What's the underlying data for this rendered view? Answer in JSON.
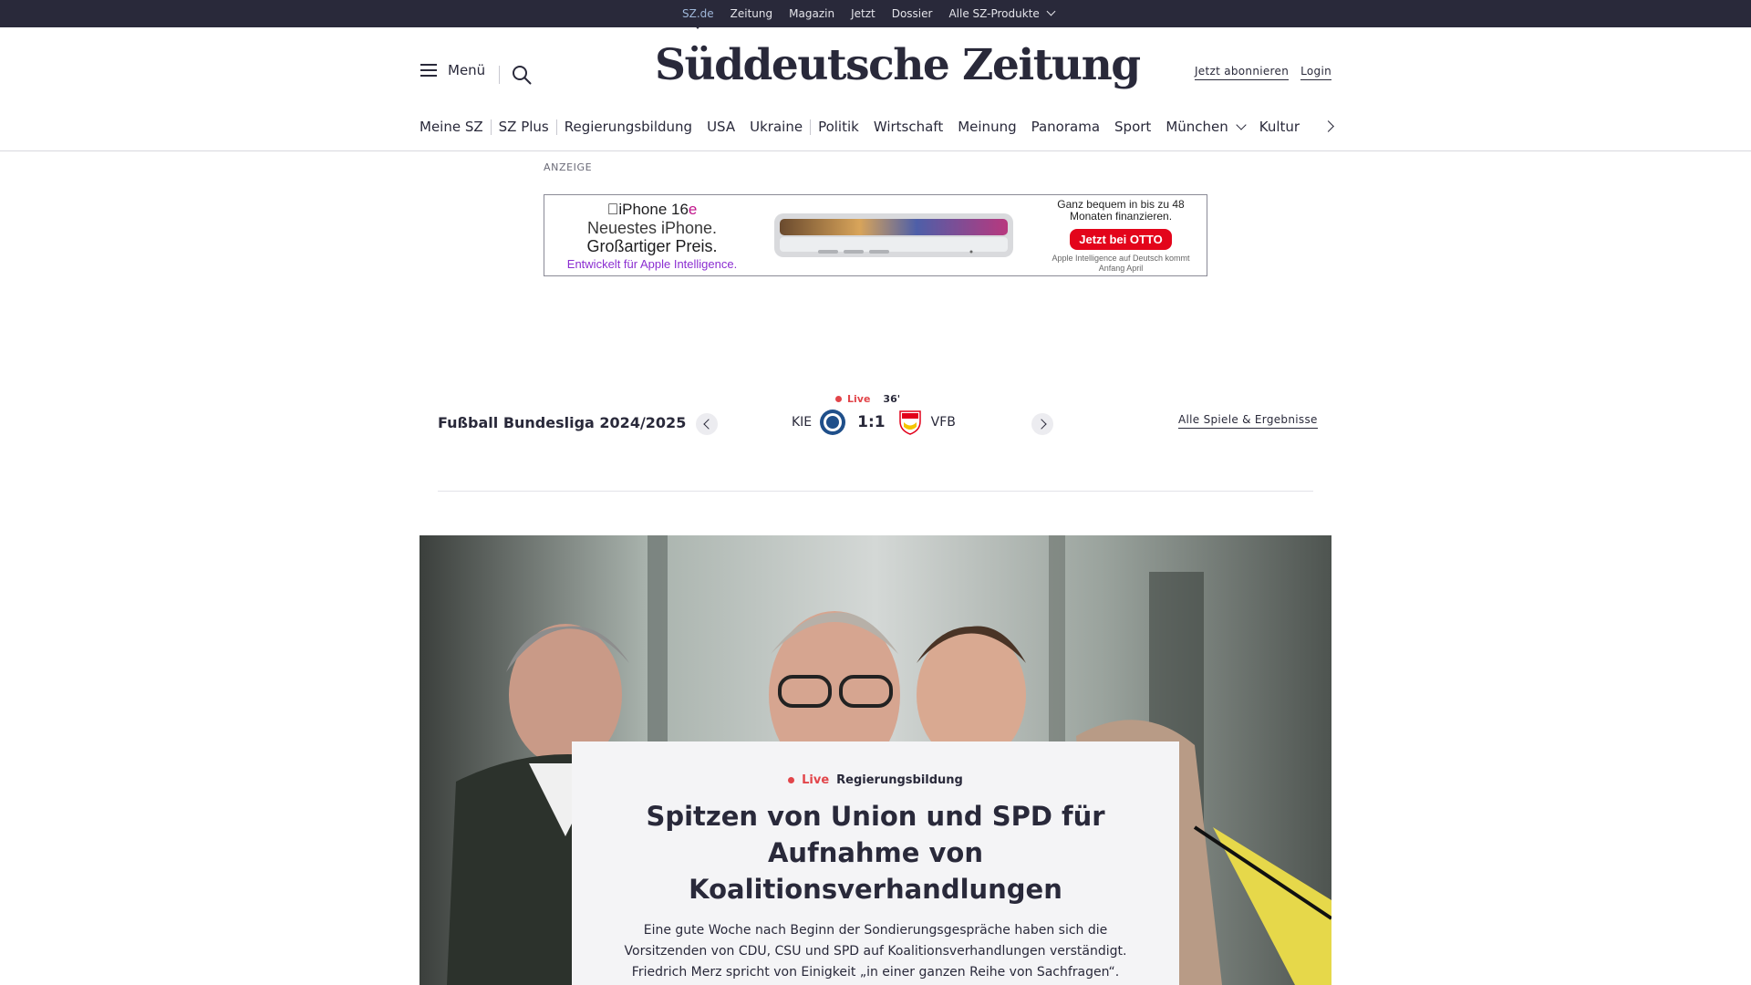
{
  "topnav": {
    "items": [
      "SZ.de",
      "Zeitung",
      "Magazin",
      "Jetzt",
      "Dossier",
      "Alle SZ-Produkte"
    ]
  },
  "header": {
    "menu_label": "Menü",
    "logo": "Süddeutsche Zeitung",
    "subscribe": "Jetzt abonnieren",
    "login": "Login"
  },
  "categories": [
    "Meine SZ",
    "SZ Plus",
    "Regierungsbildung",
    "USA",
    "Ukraine",
    "Politik",
    "Wirtschaft",
    "Meinung",
    "Panorama",
    "Sport",
    "München",
    "Kultur"
  ],
  "ad": {
    "label": "ANZEIGE",
    "product": "iPhone 16",
    "product_suffix": "e",
    "tagline1": "Neuestes iPhone.",
    "tagline2": "Großartiger Preis.",
    "ai_line": "Entwickelt für Apple Intelligence.",
    "financing": "Ganz bequem in bis zu 48 Monaten finanzieren.",
    "cta": "Jetzt bei OTTO",
    "note": "Apple Intelligence auf Deutsch kommt Anfang April",
    "accent": "#e3051b"
  },
  "scores": {
    "league": "Fußball Bundesliga 2024/2025",
    "live": "Live",
    "minute": "36'",
    "home": "KIE",
    "score": "1:1",
    "away": "VFB",
    "all_games": "Alle Spiele & Ergebnisse",
    "live_color": "#e2454a"
  },
  "teaser": {
    "live": "Live",
    "topic": "Regierungsbildung",
    "headline": "Spitzen von Union und SPD für Aufnahme von Koalitionsverhandlungen",
    "lead": "Eine gute Woche nach Beginn der Sondierungsgespräche haben sich die Vorsitzenden von CDU, CSU und SPD auf Koalitionsverhandlungen verständigt. Friedrich Merz spricht von Einigkeit „in einer ganzen Reihe von Sachfragen“."
  },
  "colors": {
    "brand_dark": "#29293a",
    "live_red": "#e2454a"
  }
}
